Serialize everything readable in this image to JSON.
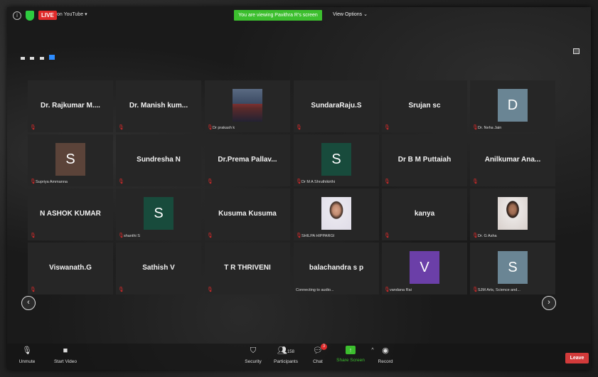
{
  "topbar": {
    "live": "LIVE",
    "live_on": "on YouTube",
    "viewing_banner": "You are viewing Pavithra R's screen",
    "view_options": "View Options"
  },
  "participants": [
    {
      "name": "Dr. Rajkumar M....",
      "sub": ""
    },
    {
      "name": "Dr. Manish kum...",
      "sub": ""
    },
    {
      "name": "",
      "sub": "Dr prakash k",
      "video": "photo-stage"
    },
    {
      "name": "SundaraRaju.S",
      "sub": ""
    },
    {
      "name": "Srujan sc",
      "sub": ""
    },
    {
      "name": "",
      "sub": "Dr. Neha Jain",
      "avatar": "D",
      "avatar_color": "#6a8594"
    },
    {
      "name": "",
      "sub": "Supriya Ammanna",
      "avatar": "S",
      "avatar_color": "#5b4339"
    },
    {
      "name": "Sundresha N",
      "sub": ""
    },
    {
      "name": "Dr.Prema Pallav...",
      "sub": ""
    },
    {
      "name": "",
      "sub": "Dr M A Shruthikirthi",
      "avatar": "S",
      "avatar_color": "#184b3c"
    },
    {
      "name": "Dr B M Puttaiah",
      "sub": ""
    },
    {
      "name": "Anilkumar Ana...",
      "sub": ""
    },
    {
      "name": "N ASHOK KUMAR",
      "sub": ""
    },
    {
      "name": "",
      "sub": "shanthi S",
      "avatar": "S",
      "avatar_color": "#184b3c"
    },
    {
      "name": "Kusuma Kusuma",
      "sub": ""
    },
    {
      "name": "",
      "sub": "SHILPA HIPPARGI",
      "video": "photo-girl"
    },
    {
      "name": "kanya",
      "sub": ""
    },
    {
      "name": "",
      "sub": "Dr. G Asha",
      "video": "photo-woman"
    },
    {
      "name": "Viswanath.G",
      "sub": ""
    },
    {
      "name": "Sathish V",
      "sub": ""
    },
    {
      "name": "T R THRIVENI",
      "sub": ""
    },
    {
      "name": "balachandra s p",
      "sub": "Connecting to audio...",
      "no_mic": true
    },
    {
      "name": "",
      "sub": "vandana Rai",
      "avatar": "V",
      "avatar_color": "#6b3fa8"
    },
    {
      "name": "",
      "sub": "SJM Arts, Science and...",
      "avatar": "S",
      "avatar_color": "#6a8594"
    }
  ],
  "toolbar": {
    "unmute": "Unmute",
    "start_video": "Start Video",
    "security": "Security",
    "participants": "Participants",
    "participants_count": "158",
    "chat": "Chat",
    "chat_badge": "3",
    "share_screen": "Share Screen",
    "record": "Record",
    "leave": "Leave"
  },
  "colors": {
    "live_red": "#e02a2a",
    "banner_green": "#3cbf2e",
    "leave_red": "#d23a3a",
    "tile_bg": "#262626"
  }
}
